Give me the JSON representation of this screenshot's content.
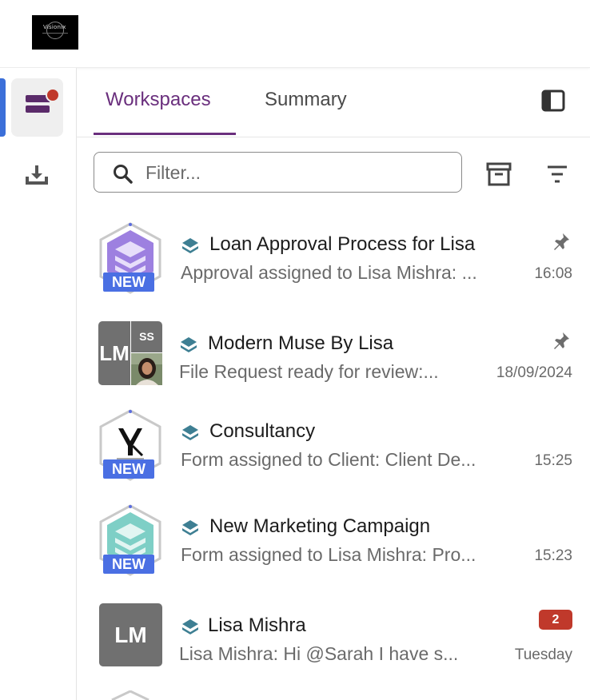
{
  "header": {
    "logo_text": "Visionix"
  },
  "tabs": {
    "workspaces": "Workspaces",
    "summary": "Summary"
  },
  "filter": {
    "placeholder": "Filter..."
  },
  "items": [
    {
      "title": "Loan Approval Process for Lisa",
      "subtitle": "Approval assigned to Lisa Mishra: ...",
      "time": "16:08",
      "badge_new": "NEW",
      "pinned": true,
      "avatar_color": "#8e63d6"
    },
    {
      "title": "Modern Muse By Lisa",
      "subtitle": "File Request ready for review:...",
      "time": "18/09/2024",
      "initials": "LM",
      "initials2": "SS",
      "pinned": true
    },
    {
      "title": "Consultancy",
      "subtitle": "Form assigned to Client: Client De...",
      "time": "15:25",
      "badge_new": "NEW",
      "logo_text": "VK"
    },
    {
      "title": "New Marketing Campaign",
      "subtitle": "Form assigned to Lisa Mishra: Pro...",
      "time": "15:23",
      "badge_new": "NEW",
      "avatar_color": "#6fc4be"
    },
    {
      "title": "Lisa Mishra",
      "subtitle": "Lisa Mishra: Hi @Sarah I have s...",
      "time": "Tuesday",
      "initials": "LM",
      "unread_count": "2"
    }
  ],
  "colors": {
    "accent": "#6a2f7d",
    "new_badge": "#4a6fe3",
    "unread": "#c0392b",
    "stack_icon": "#3e7f93"
  }
}
